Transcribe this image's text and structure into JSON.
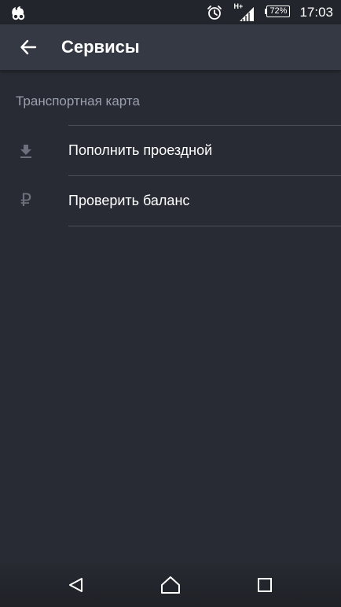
{
  "status_bar": {
    "network_type": "H+",
    "battery_percent": "72%",
    "time": "17:03",
    "icons": [
      "uc-browser-icon",
      "alarm-icon",
      "signal-icon",
      "battery-icon"
    ]
  },
  "app_bar": {
    "title": "Сервисы",
    "back_icon": "arrow-back-icon"
  },
  "section": {
    "header": "Транспортная карта",
    "items": [
      {
        "label": "Пополнить проездной",
        "icon": "download-icon"
      },
      {
        "label": "Проверить баланс",
        "icon": "ruble-icon",
        "glyph": "₽"
      }
    ]
  },
  "nav_bar": {
    "icons": [
      "back-triangle-icon",
      "home-icon",
      "recents-square-icon"
    ]
  },
  "colors": {
    "background": "#282b33",
    "app_bar": "#353944",
    "status_bar": "#23252c",
    "section_header": "#9aa0ad",
    "icon": "#6b707c",
    "divider": "#4a4e59"
  }
}
